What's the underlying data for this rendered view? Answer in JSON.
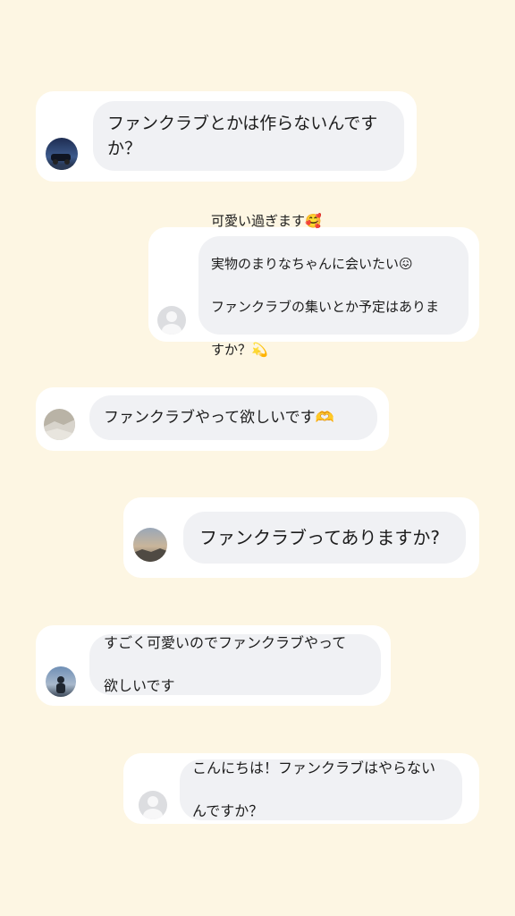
{
  "messages": [
    {
      "id": "m1",
      "text": "ファンクラブとかは作らないんですか？",
      "avatar": "photo-car-night"
    },
    {
      "id": "m2",
      "lines": [
        "可愛い過ぎます🥰",
        "実物のまりなちゃんに会いたい😖",
        "ファンクラブの集いとか予定はありま",
        "すか？💫"
      ],
      "avatar": "default-gray"
    },
    {
      "id": "m3",
      "text": "ファンクラブやって欲しいです🫶",
      "avatar": "photo-landscape"
    },
    {
      "id": "m4",
      "text": "ファンクラブってありますか?",
      "avatar": "photo-sky"
    },
    {
      "id": "m5",
      "lines": [
        "すごく可愛いのでファンクラブやって",
        "欲しいです"
      ],
      "avatar": "photo-person"
    },
    {
      "id": "m6",
      "lines": [
        "こんにちは！ファンクラブはやらない",
        "んですか？"
      ],
      "avatar": "default-gray"
    }
  ],
  "colors": {
    "background": "#fdf6e3",
    "card": "#ffffff",
    "bubble": "#f0f1f4",
    "text": "#1c1c1c"
  }
}
